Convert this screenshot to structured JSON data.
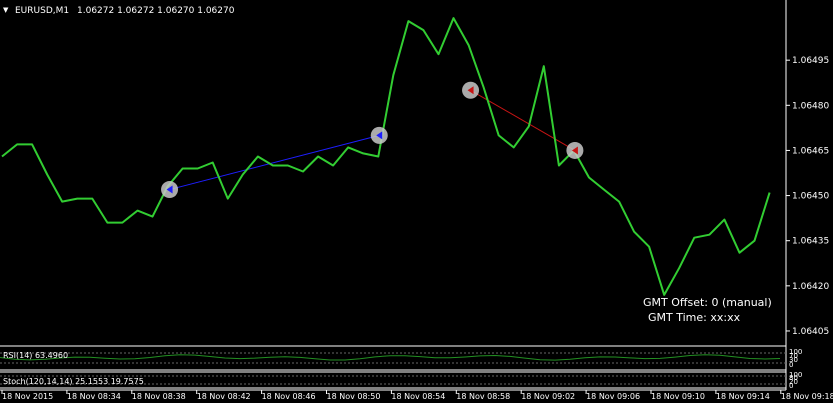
{
  "header": {
    "arrow_glyph": "▼",
    "symbol": "EURUSD,M1",
    "ohlc": "1.06272 1.06272 1.06270 1.06270"
  },
  "info": {
    "gmt_offset": "GMT Offset: 0 (manual)",
    "gmt_time": "GMT Time: xx:xx"
  },
  "rsi": {
    "label": "RSI(14) 63.4960",
    "levels": [
      "100",
      "70",
      "30",
      "0"
    ]
  },
  "stoch": {
    "label": "Stoch(120,14,14) 25.1553 19.7575",
    "levels": [
      "100",
      "80",
      "20",
      "0"
    ]
  },
  "colors": {
    "background": "#000000",
    "price_line": "#32cd32",
    "buy_line": "#1e1eff",
    "sell_line": "#c81414",
    "separator": "#ffffff",
    "text": "#ffffff"
  },
  "chart_data": {
    "type": "line",
    "title": "EURUSD,M1",
    "ylim": [
      1.06401,
      1.06515
    ],
    "y_ticks": [
      1.06495,
      1.0648,
      1.06465,
      1.0645,
      1.06435,
      1.0642,
      1.06405
    ],
    "y_tick_labels": [
      "1.06495",
      "1.06480",
      "1.06465",
      "1.06450",
      "1.06435",
      "1.06420",
      "1.06405"
    ],
    "x_tick_labels": [
      "18 Nov 2015",
      "18 Nov 08:34",
      "18 Nov 08:38",
      "18 Nov 08:42",
      "18 Nov 08:46",
      "18 Nov 08:50",
      "18 Nov 08:54",
      "18 Nov 08:58",
      "18 Nov 09:02",
      "18 Nov 09:06",
      "18 Nov 09:10",
      "18 Nov 09:14",
      "18 Nov 09:18"
    ],
    "series": [
      {
        "values": [
          1.06463,
          1.06467,
          1.06467,
          1.06457,
          1.06448,
          1.06449,
          1.06449,
          1.06441,
          1.06441,
          1.06445,
          1.06443,
          1.06453,
          1.06459,
          1.06459,
          1.06461,
          1.06449,
          1.06457,
          1.06463,
          1.0646,
          1.0646,
          1.06458,
          1.06463,
          1.0646,
          1.06466,
          1.06464,
          1.06463,
          1.0649,
          1.06508,
          1.06505,
          1.06497,
          1.06509,
          1.065,
          1.06486,
          1.0647,
          1.06466,
          1.06473,
          1.06493,
          1.0646,
          1.06465,
          1.06456,
          1.06452,
          1.06448,
          1.06438,
          1.06433,
          1.06417,
          1.06426,
          1.06436,
          1.06437,
          1.06442,
          1.06431,
          1.06435,
          1.06451
        ]
      }
    ],
    "trades": [
      {
        "type": "buy",
        "open_price": 1.06452,
        "close_price": 1.0647
      },
      {
        "type": "sell",
        "open_price": 1.06485,
        "close_price": 1.06465
      }
    ]
  }
}
